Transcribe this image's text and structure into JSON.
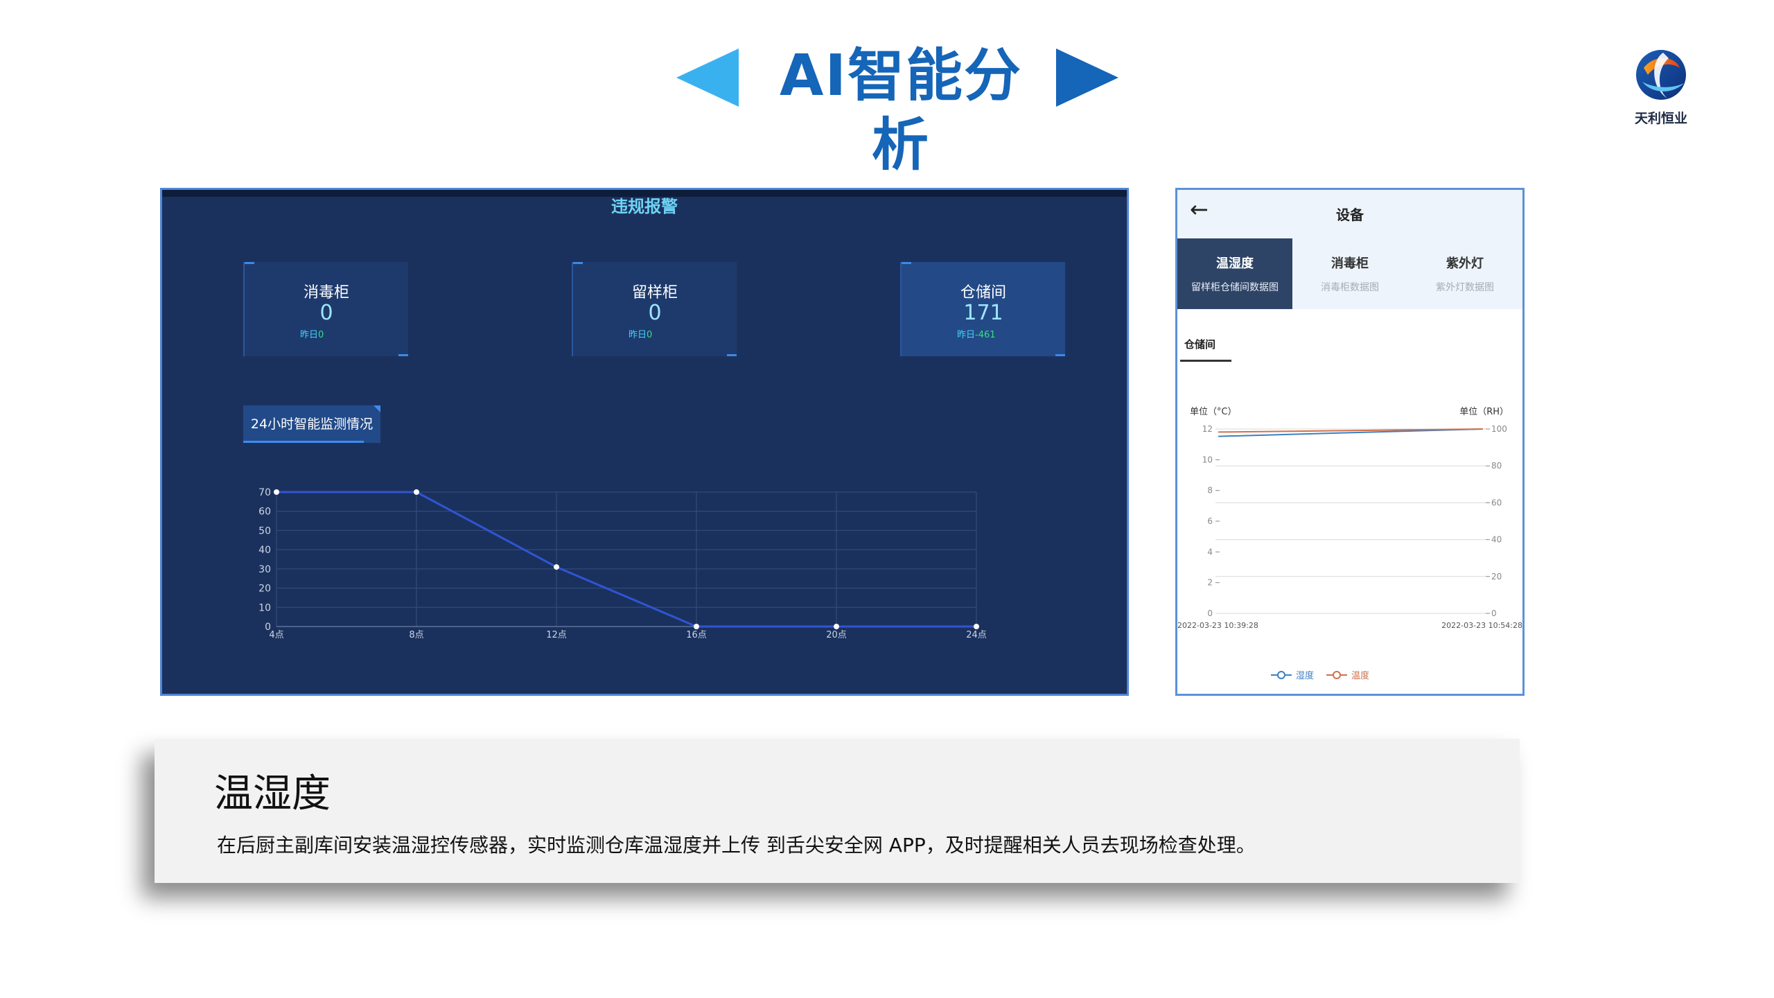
{
  "header": {
    "title": "AI智能分析",
    "left_arrow_color": "#3ab1ef",
    "right_arrow_color": "#1565b8"
  },
  "logo": {
    "text": "天利恒业"
  },
  "dashboard": {
    "title": "违规报警",
    "cards": [
      {
        "label": "消毒柜",
        "value": "0",
        "sub_label": "昨日",
        "sub_value": "0"
      },
      {
        "label": "留样柜",
        "value": "0",
        "sub_label": "昨日",
        "sub_value": "0"
      },
      {
        "label": "仓储间",
        "value": "171",
        "sub_label": "昨日",
        "sub_value": "-461"
      }
    ],
    "section_title": "24小时智能监测情况"
  },
  "chart_data": [
    {
      "type": "line",
      "categories": [
        "4点",
        "8点",
        "12点",
        "16点",
        "20点",
        "24点"
      ],
      "values": [
        70,
        70,
        31,
        0,
        0,
        0
      ],
      "ylim": [
        0,
        70
      ],
      "yticks": [
        0,
        10,
        20,
        30,
        40,
        50,
        60,
        70
      ],
      "grid": true,
      "line_color": "#2f55d4"
    },
    {
      "type": "line",
      "x": [
        "2022-03-23 10:39:28",
        "2022-03-23 10:54:28"
      ],
      "left_axis_label": "单位（°C）",
      "right_axis_label": "单位（RH）",
      "left_ylim": [
        0,
        12
      ],
      "left_ticks": [
        0,
        2,
        4,
        6,
        8,
        10,
        12
      ],
      "right_ylim": [
        0,
        100
      ],
      "right_ticks": [
        0,
        20,
        40,
        60,
        80,
        100
      ],
      "series": [
        {
          "name": "湿度",
          "values": [
            96,
            100
          ],
          "axis": "right",
          "color": "#3c7fc2"
        },
        {
          "name": "温度",
          "values": [
            11.8,
            12.0
          ],
          "axis": "left",
          "color": "#d0704c"
        }
      ],
      "legend": "bottom",
      "grid": true
    }
  ],
  "phone": {
    "back_icon": "arrow-left-icon",
    "title": "设备",
    "tabs": [
      {
        "label": "温湿度",
        "sub": "留样柜仓储间数据图"
      },
      {
        "label": "消毒柜",
        "sub": "消毒柜数据图"
      },
      {
        "label": "紫外灯",
        "sub": "紫外灯数据图"
      }
    ],
    "subtab": "仓储间"
  },
  "description": {
    "title": "温湿度",
    "text": "在后厨主副库间安装温湿控传感器，实时监测仓库温湿度并上传 到舌尖安全网 APP，及时提醒相关人员去现场检查处理。"
  }
}
